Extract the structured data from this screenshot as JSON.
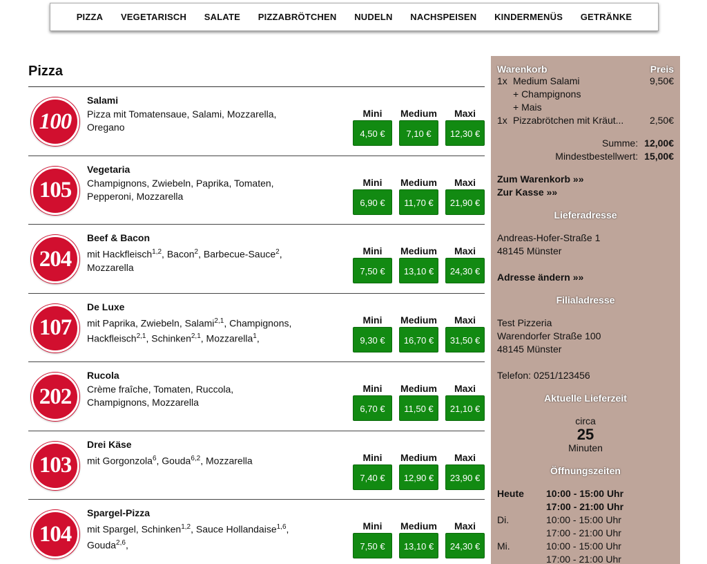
{
  "nav": [
    "PIZZA",
    "VEGETARISCH",
    "SALATE",
    "PIZZABRÖTCHEN",
    "NUDELN",
    "NACHSPEISEN",
    "KINDERMENÜS",
    "GETRÄNKE"
  ],
  "section_title": "Pizza",
  "size_labels": [
    "Mini",
    "Medium",
    "Maxi"
  ],
  "items": [
    {
      "number": "100",
      "name": "Salami",
      "desc_html": "Pizza mit Tomatensaue, Salami, Mozzarella, Oregano",
      "prices": [
        "4,50 €",
        "7,10 €",
        "12,30 €"
      ]
    },
    {
      "number": "105",
      "name": "Vegetaria",
      "desc_html": "Champignons, Zwiebeln, Paprika, Tomaten, Pepperoni, Mozzarella",
      "prices": [
        "6,90 €",
        "11,70 €",
        "21,90 €"
      ]
    },
    {
      "number": "204",
      "name": "Beef & Bacon",
      "desc_html": "mit Hackfleisch<sup>1,2</sup>, Bacon<sup>2</sup>, Barbecue-Sauce<sup>2</sup>, Mozzarella",
      "prices": [
        "7,50 €",
        "13,10 €",
        "24,30 €"
      ]
    },
    {
      "number": "107",
      "name": "De Luxe",
      "desc_html": "mit Paprika, Zwiebeln, Salami<sup>2,1</sup>, Champignons, Hackfleisch<sup>2,1</sup>, Schinken<sup>2,1</sup>, Mozzarella<sup>1</sup>,",
      "prices": [
        "9,30 €",
        "16,70 €",
        "31,50 €"
      ]
    },
    {
      "number": "202",
      "name": "Rucola",
      "desc_html": "Crème fraîche, Tomaten, Ruccola, Champignons, Mozzarella",
      "prices": [
        "6,70 €",
        "11,50 €",
        "21,10 €"
      ]
    },
    {
      "number": "103",
      "name": "Drei Käse",
      "desc_html": "mit Gorgonzola<sup>6</sup>, Gouda<sup>6,2</sup>, Mozzarella",
      "prices": [
        "7,40 €",
        "12,90 €",
        "23,90 €"
      ]
    },
    {
      "number": "104",
      "name": "Spargel-Pizza",
      "desc_html": "mit Spargel, Schinken<sup>1,2</sup>, Sauce Hollandaise<sup>1,6</sup>, Gouda<sup>2,6</sup>,",
      "prices": [
        "7,50 €",
        "13,10 €",
        "24,30 €"
      ]
    }
  ],
  "cart": {
    "title": "Warenkorb",
    "price_header": "Preis",
    "line1_qty": "1x",
    "line1_name": "Medium Salami",
    "line1_price": "9,50€",
    "extra1": "+ Champignons",
    "extra2": "+ Mais",
    "line2_qty": "1x",
    "line2_name": "Pizzabrötchen mit Kräut...",
    "line2_price": "2,50€",
    "sum_label": "Summe:",
    "sum_value": "12,00€",
    "min_label": "Mindestbestellwert:",
    "min_value": "15,00€",
    "link_cart": "Zum Warenkorb »»",
    "link_checkout": "Zur Kasse »»"
  },
  "delivery": {
    "title": "Lieferadresse",
    "street": "Andreas-Hofer-Straße 1",
    "city": "48145 Münster",
    "change_link": "Adresse ändern »»"
  },
  "branch": {
    "title": "Filialadresse",
    "name": "Test Pizzeria",
    "street": "Warendorfer Straße 100",
    "city": "48145 Münster",
    "phone": "Telefon: 0251/123456"
  },
  "delivery_time": {
    "title": "Aktuelle Lieferzeit",
    "prefix": "circa",
    "value": "25",
    "unit": "Minuten"
  },
  "hours": {
    "title": "Öffnungszeiten",
    "today_label": "Heute",
    "today_1": "10:00 - 15:00 Uhr",
    "today_2": "17:00 - 21:00 Uhr",
    "di_label": "Di.",
    "di_1": "10:00 - 15:00 Uhr",
    "di_2": "17:00 - 21:00 Uhr",
    "mi_label": "Mi.",
    "mi_1": "10:00 - 15:00 Uhr",
    "mi_2": "17:00 - 21:00 Uhr"
  },
  "colors": {
    "badge": "#d10f2f",
    "price_button": "#128a12",
    "sidebar": "#bea59a"
  }
}
